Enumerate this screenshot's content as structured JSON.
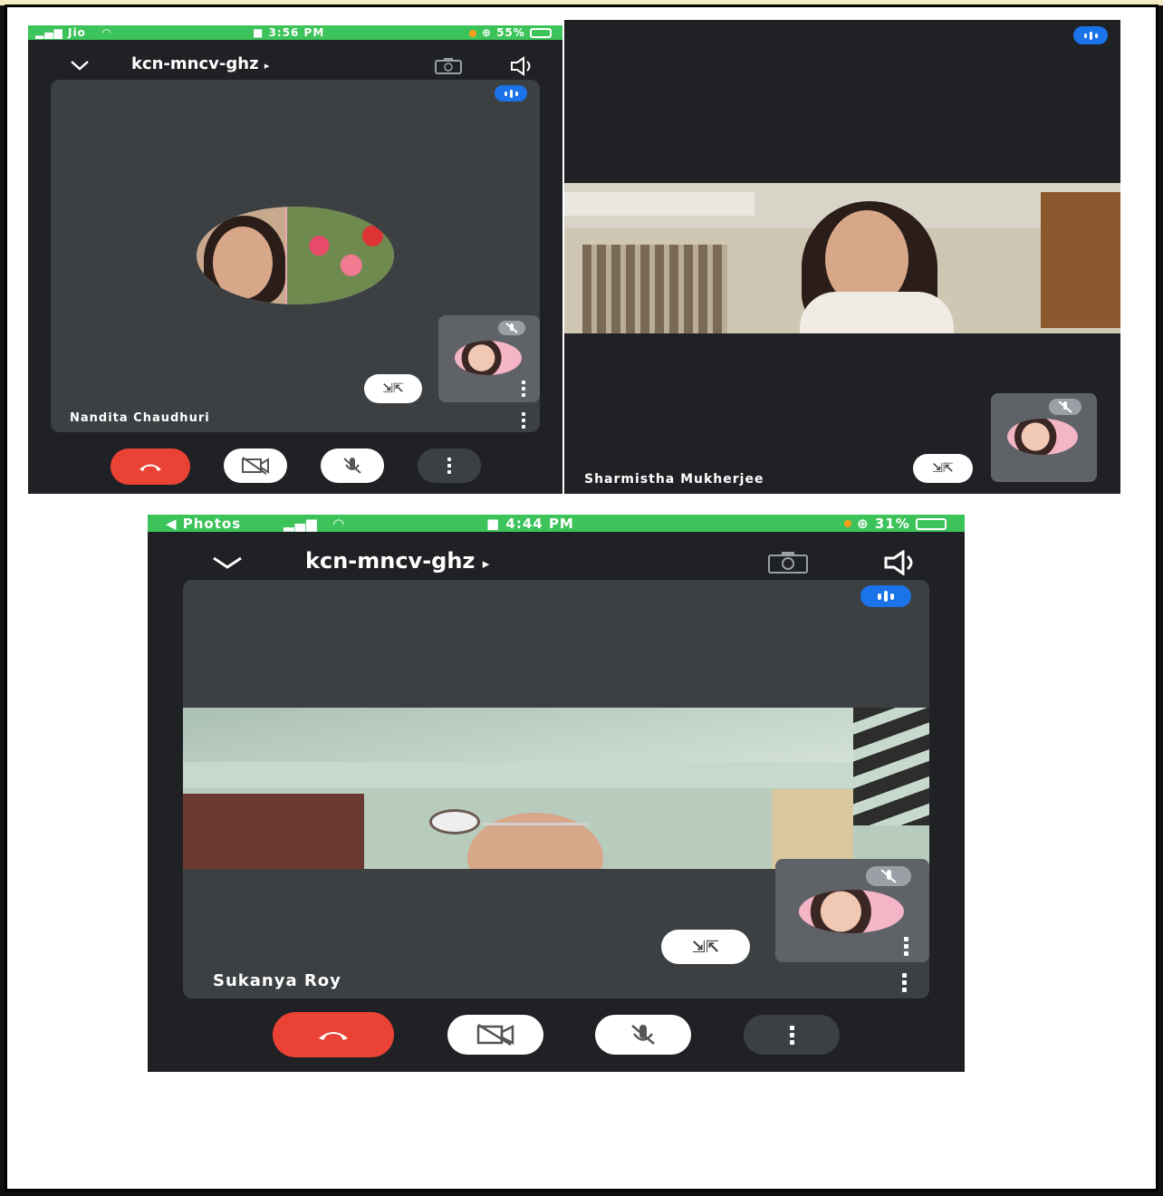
{
  "screens": [
    {
      "status": {
        "carrier": "Jio",
        "time": "3:56 PM",
        "battery": "55%"
      },
      "meeting_code": "kcn-mncv-ghz",
      "participant": "Nandita Chaudhuri"
    },
    {
      "participant": "Sharmistha Mukherjee"
    },
    {
      "status": {
        "carrier": "◀ Photos",
        "time": "4:44 PM",
        "battery": "31%"
      },
      "meeting_code": "kcn-mncv-ghz",
      "participant": "Sukanya Roy"
    }
  ],
  "icons": {
    "end_call": "phone-hangup-icon",
    "camera_off": "video-off-icon",
    "mic_off": "mic-off-icon",
    "more": "more-vert-icon",
    "speaker": "speaker-icon",
    "switch_camera": "switch-camera-icon",
    "collapse": "collapse-icon"
  },
  "colors": {
    "end_call": "#ea4335",
    "status_bar": "#3cc35a",
    "active_speaker": "#1a73e8",
    "call_bg": "#202124"
  }
}
